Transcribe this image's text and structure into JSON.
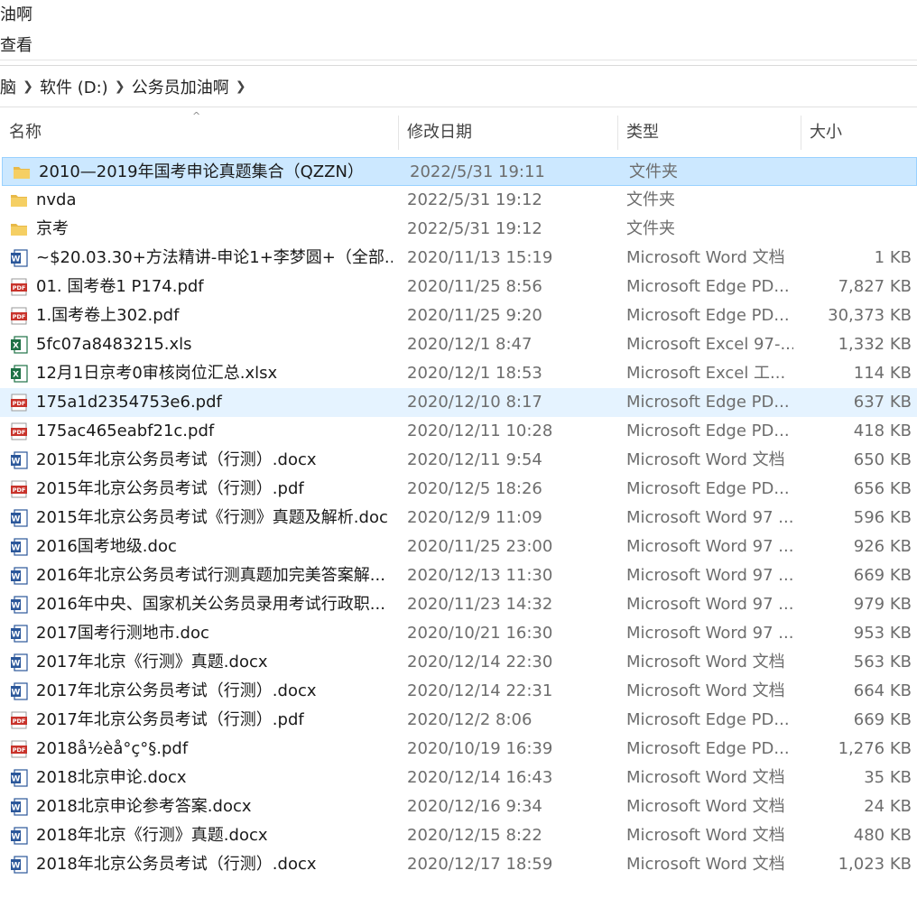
{
  "window": {
    "title_fragment": "油啊"
  },
  "menu": {
    "view_label": "查看"
  },
  "breadcrumb": [
    {
      "label": "脑"
    },
    {
      "label": "软件 (D:)"
    },
    {
      "label": "公务员加油啊"
    }
  ],
  "columns": {
    "name": "名称",
    "date": "修改日期",
    "type": "类型",
    "size": "大小"
  },
  "files": [
    {
      "name": "2010—2019年国考申论真题集合（QZZN）",
      "date": "2022/5/31 19:11",
      "type": "文件夹",
      "size": "",
      "icon": "folder-icon",
      "state": "selected"
    },
    {
      "name": "nvda",
      "date": "2022/5/31 19:12",
      "type": "文件夹",
      "size": "",
      "icon": "folder-icon",
      "state": ""
    },
    {
      "name": "京考",
      "date": "2022/5/31 19:12",
      "type": "文件夹",
      "size": "",
      "icon": "folder-icon",
      "state": ""
    },
    {
      "name": "~$20.03.30+方法精讲-申论1+李梦圆+（全部...",
      "date": "2020/11/13 15:19",
      "type": "Microsoft Word 文档",
      "size": "1 KB",
      "icon": "word-icon",
      "state": ""
    },
    {
      "name": "01. 国考卷1 P174.pdf",
      "date": "2020/11/25 8:56",
      "type": "Microsoft Edge PD...",
      "size": "7,827 KB",
      "icon": "pdf-icon",
      "state": ""
    },
    {
      "name": "1.国考卷上302.pdf",
      "date": "2020/11/25 9:20",
      "type": "Microsoft Edge PD...",
      "size": "30,373 KB",
      "icon": "pdf-icon",
      "state": ""
    },
    {
      "name": "5fc07a8483215.xls",
      "date": "2020/12/1 8:47",
      "type": "Microsoft Excel 97-...",
      "size": "1,332 KB",
      "icon": "excel-icon",
      "state": ""
    },
    {
      "name": "12月1日京考0审核岗位汇总.xlsx",
      "date": "2020/12/1 18:53",
      "type": "Microsoft Excel 工...",
      "size": "114 KB",
      "icon": "excel-icon",
      "state": ""
    },
    {
      "name": "175a1d2354753e6.pdf",
      "date": "2020/12/10 8:17",
      "type": "Microsoft Edge PD...",
      "size": "637 KB",
      "icon": "pdf-icon",
      "state": "hover"
    },
    {
      "name": "175ac465eabf21c.pdf",
      "date": "2020/12/11 10:28",
      "type": "Microsoft Edge PD...",
      "size": "418 KB",
      "icon": "pdf-icon",
      "state": ""
    },
    {
      "name": "2015年北京公务员考试（行测）.docx",
      "date": "2020/12/11 9:54",
      "type": "Microsoft Word 文档",
      "size": "650 KB",
      "icon": "word-icon",
      "state": ""
    },
    {
      "name": "2015年北京公务员考试（行测）.pdf",
      "date": "2020/12/5 18:26",
      "type": "Microsoft Edge PD...",
      "size": "656 KB",
      "icon": "pdf-icon",
      "state": ""
    },
    {
      "name": "2015年北京公务员考试《行测》真题及解析.doc",
      "date": "2020/12/9 11:09",
      "type": "Microsoft Word 97 ...",
      "size": "596 KB",
      "icon": "word-icon",
      "state": ""
    },
    {
      "name": "2016国考地级.doc",
      "date": "2020/11/25 23:00",
      "type": "Microsoft Word 97 ...",
      "size": "926 KB",
      "icon": "word-icon",
      "state": ""
    },
    {
      "name": "2016年北京公务员考试行测真题加完美答案解...",
      "date": "2020/12/13 11:30",
      "type": "Microsoft Word 97 ...",
      "size": "669 KB",
      "icon": "word-icon",
      "state": ""
    },
    {
      "name": "2016年中央、国家机关公务员录用考试行政职...",
      "date": "2020/11/23 14:32",
      "type": "Microsoft Word 97 ...",
      "size": "979 KB",
      "icon": "word-icon",
      "state": ""
    },
    {
      "name": "2017国考行测地市.doc",
      "date": "2020/10/21 16:30",
      "type": "Microsoft Word 97 ...",
      "size": "953 KB",
      "icon": "word-icon",
      "state": ""
    },
    {
      "name": "2017年北京《行测》真题.docx",
      "date": "2020/12/14 22:30",
      "type": "Microsoft Word 文档",
      "size": "563 KB",
      "icon": "word-icon",
      "state": ""
    },
    {
      "name": "2017年北京公务员考试（行测）.docx",
      "date": "2020/12/14 22:31",
      "type": "Microsoft Word 文档",
      "size": "664 KB",
      "icon": "word-icon",
      "state": ""
    },
    {
      "name": "2017年北京公务员考试（行测）.pdf",
      "date": "2020/12/2 8:06",
      "type": "Microsoft Edge PD...",
      "size": "669 KB",
      "icon": "pdf-icon",
      "state": ""
    },
    {
      "name": "2018å½èå°ç°§.pdf",
      "date": "2020/10/19 16:39",
      "type": "Microsoft Edge PD...",
      "size": "1,276 KB",
      "icon": "pdf-icon",
      "state": ""
    },
    {
      "name": "2018北京申论.docx",
      "date": "2020/12/14 16:43",
      "type": "Microsoft Word 文档",
      "size": "35 KB",
      "icon": "word-icon",
      "state": ""
    },
    {
      "name": "2018北京申论参考答案.docx",
      "date": "2020/12/16 9:34",
      "type": "Microsoft Word 文档",
      "size": "24 KB",
      "icon": "word-icon",
      "state": ""
    },
    {
      "name": "2018年北京《行测》真题.docx",
      "date": "2020/12/15 8:22",
      "type": "Microsoft Word 文档",
      "size": "480 KB",
      "icon": "word-icon",
      "state": ""
    },
    {
      "name": "2018年北京公务员考试（行测）.docx",
      "date": "2020/12/17 18:59",
      "type": "Microsoft Word 文档",
      "size": "1,023 KB",
      "icon": "word-icon",
      "state": ""
    }
  ],
  "colors": {
    "selected_bg": "#cce8ff",
    "hover_bg": "#e5f3ff",
    "folder": "#e8b948",
    "word": "#2b579a",
    "pdf": "#c8332b",
    "excel": "#1e7145"
  }
}
